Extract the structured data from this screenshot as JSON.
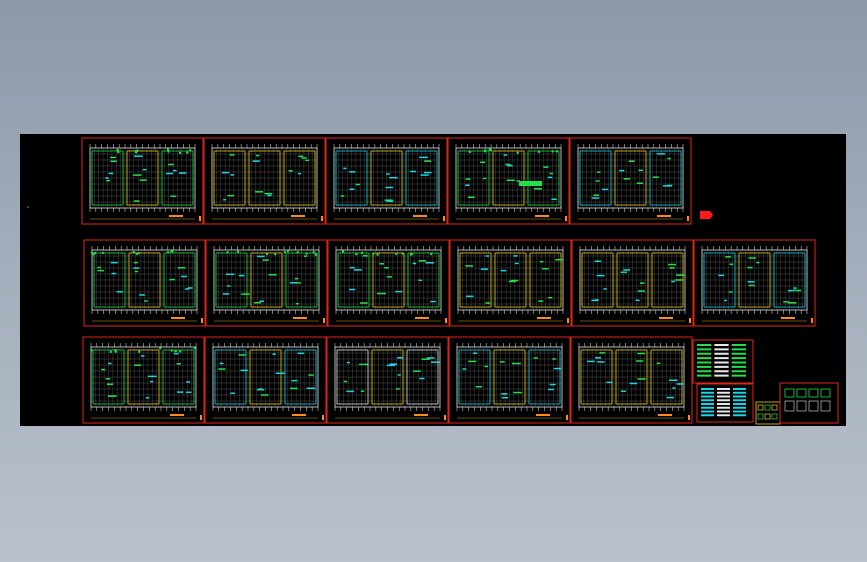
{
  "viewer": {
    "title": "",
    "background": "#9aa5b3",
    "canvas_background": "#000000"
  },
  "colors": {
    "frame": "#e0241c",
    "grid_white": "#e8e8e8",
    "cyan": "#19d6e6",
    "green": "#23e04a",
    "yellow": "#f0d020",
    "orange": "#ff8a1a",
    "red_marker": "#ff1a1a"
  },
  "sheets": [
    {
      "row": 1,
      "theme": "plan-green"
    },
    {
      "row": 1,
      "theme": "plan-yellow"
    },
    {
      "row": 1,
      "theme": "plan-cyan"
    },
    {
      "row": 1,
      "theme": "plan-yellow-green"
    },
    {
      "row": 1,
      "theme": "plan-cyan"
    },
    {
      "row": 2,
      "theme": "plan-green"
    },
    {
      "row": 2,
      "theme": "plan-green"
    },
    {
      "row": 2,
      "theme": "plan-green"
    },
    {
      "row": 2,
      "theme": "plan-yellow"
    },
    {
      "row": 2,
      "theme": "plan-yellow"
    },
    {
      "row": 2,
      "theme": "plan-cyan"
    },
    {
      "row": 3,
      "theme": "plan-green"
    },
    {
      "row": 3,
      "theme": "plan-cyan"
    },
    {
      "row": 3,
      "theme": "plan-white"
    },
    {
      "row": 3,
      "theme": "plan-cyan"
    },
    {
      "row": 3,
      "theme": "plan-yellow"
    }
  ],
  "extras": [
    {
      "kind": "legend-table",
      "theme": "green"
    },
    {
      "kind": "schedule-table",
      "theme": "cyan"
    },
    {
      "kind": "detail-block",
      "theme": "yellow"
    },
    {
      "kind": "detail-sheet",
      "theme": "green"
    }
  ],
  "markers": [
    {
      "kind": "red-tag-icon"
    }
  ]
}
